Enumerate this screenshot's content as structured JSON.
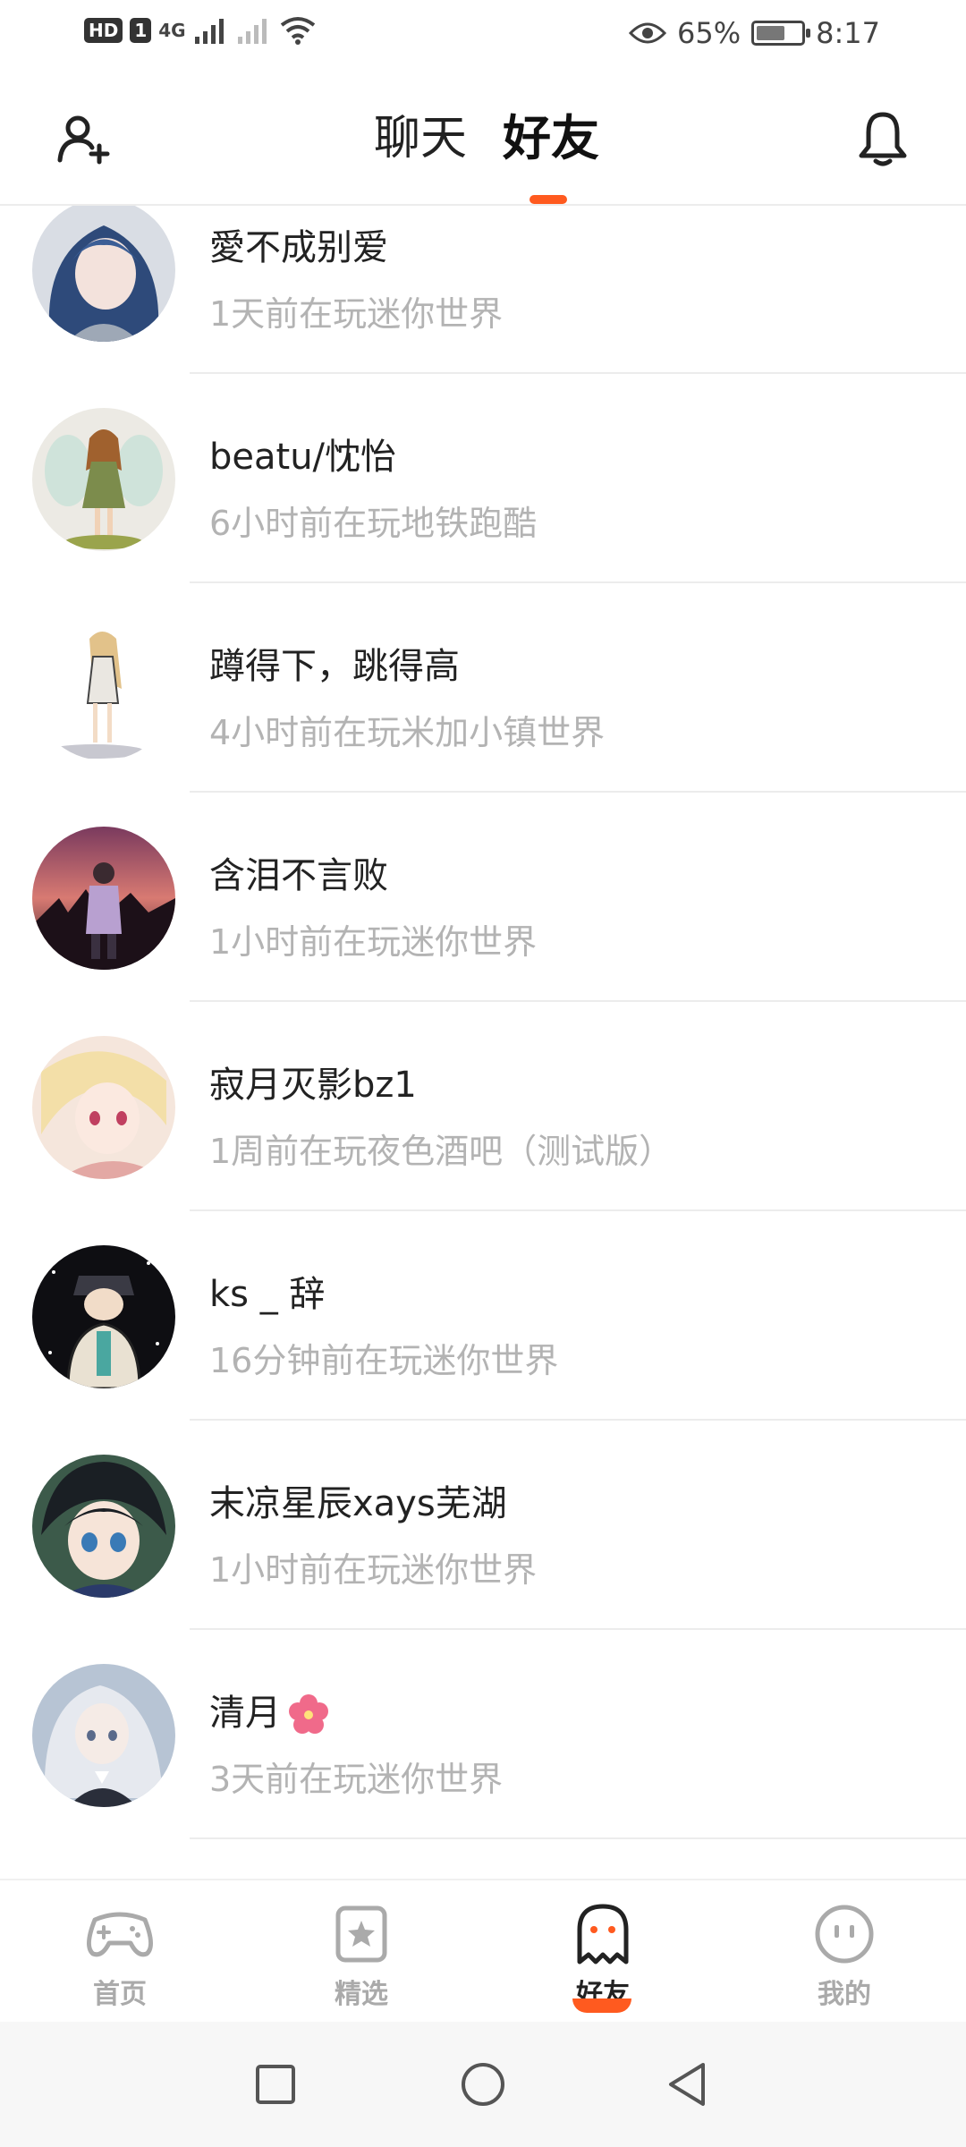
{
  "status_bar": {
    "hd_label": "HD",
    "sim_label": "1",
    "network_label": "4G",
    "battery_percent": "65%",
    "battery_level": 0.65,
    "time": "8:17"
  },
  "header": {
    "tabs": [
      {
        "label": "聊天",
        "active": false
      },
      {
        "label": "好友",
        "active": true
      }
    ],
    "accent_color": "#ff5a1f"
  },
  "friends": [
    {
      "name": "愛不成别爱",
      "status": "1天前在玩迷你世界",
      "avatar": "anime-girl-blue-hair"
    },
    {
      "name": "beatu/忱怡",
      "status": "6小时前在玩地铁跑酷",
      "avatar": "fairy-girl-illustration"
    },
    {
      "name": "蹲得下，跳得高",
      "status": "4小时前在玩米加小镇世界",
      "avatar": "standing-girl-illustration"
    },
    {
      "name": "含泪不言败",
      "status": "1小时前在玩迷你世界",
      "avatar": "sunset-girl"
    },
    {
      "name": "寂月灭影bz1",
      "status": "1周前在玩夜色酒吧（测试版）",
      "avatar": "blonde-anime-character"
    },
    {
      "name": "ks _ 辞",
      "status": "16分钟前在玩迷你世界",
      "avatar": "hooded-character"
    },
    {
      "name": "末凉星辰xays芜湖",
      "status": "1小时前在玩迷你世界",
      "avatar": "dark-hair-anime-boy"
    },
    {
      "name": "清月",
      "status": "3天前在玩迷你世界",
      "avatar": "white-hair-anime-girl",
      "emoji": "flower"
    }
  ],
  "bottom_nav": [
    {
      "label": "首页",
      "icon": "gamepad-icon",
      "active": false
    },
    {
      "label": "精选",
      "icon": "star-card-icon",
      "active": false
    },
    {
      "label": "好友",
      "icon": "ghost-icon",
      "active": true
    },
    {
      "label": "我的",
      "icon": "smiley-icon",
      "active": false
    }
  ],
  "system_nav": [
    "recent-apps",
    "home",
    "back"
  ]
}
